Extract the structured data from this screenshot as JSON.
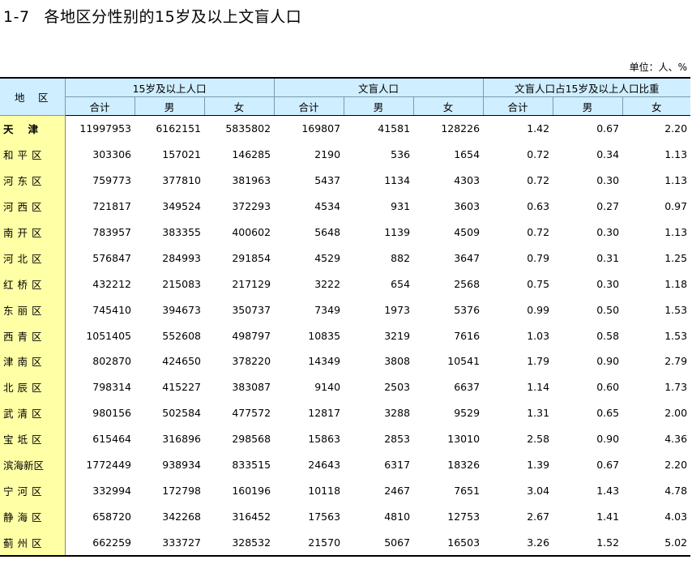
{
  "title": {
    "number": "1-7",
    "text": "各地区分性别的15岁及以上文盲人口"
  },
  "unit": "单位：人、%",
  "header": {
    "region": "地　区",
    "groups": [
      "15岁及以上人口",
      "文盲人口",
      "文盲人口占15岁及以上人口比重"
    ],
    "sub": [
      "合计",
      "男",
      "女",
      "合计",
      "男",
      "女",
      "合计",
      "男",
      "女"
    ]
  },
  "rows": [
    {
      "region": "天津",
      "values": [
        "11997953",
        "6162151",
        "5835802",
        "169807",
        "41581",
        "128226",
        "1.42",
        "0.67",
        "2.20"
      ]
    },
    {
      "region": "和平区",
      "values": [
        "303306",
        "157021",
        "146285",
        "2190",
        "536",
        "1654",
        "0.72",
        "0.34",
        "1.13"
      ]
    },
    {
      "region": "河东区",
      "values": [
        "759773",
        "377810",
        "381963",
        "5437",
        "1134",
        "4303",
        "0.72",
        "0.30",
        "1.13"
      ]
    },
    {
      "region": "河西区",
      "values": [
        "721817",
        "349524",
        "372293",
        "4534",
        "931",
        "3603",
        "0.63",
        "0.27",
        "0.97"
      ]
    },
    {
      "region": "南开区",
      "values": [
        "783957",
        "383355",
        "400602",
        "5648",
        "1139",
        "4509",
        "0.72",
        "0.30",
        "1.13"
      ]
    },
    {
      "region": "河北区",
      "values": [
        "576847",
        "284993",
        "291854",
        "4529",
        "882",
        "3647",
        "0.79",
        "0.31",
        "1.25"
      ]
    },
    {
      "region": "红桥区",
      "values": [
        "432212",
        "215083",
        "217129",
        "3222",
        "654",
        "2568",
        "0.75",
        "0.30",
        "1.18"
      ]
    },
    {
      "region": "东丽区",
      "values": [
        "745410",
        "394673",
        "350737",
        "7349",
        "1973",
        "5376",
        "0.99",
        "0.50",
        "1.53"
      ]
    },
    {
      "region": "西青区",
      "values": [
        "1051405",
        "552608",
        "498797",
        "10835",
        "3219",
        "7616",
        "1.03",
        "0.58",
        "1.53"
      ]
    },
    {
      "region": "津南区",
      "values": [
        "802870",
        "424650",
        "378220",
        "14349",
        "3808",
        "10541",
        "1.79",
        "0.90",
        "2.79"
      ]
    },
    {
      "region": "北辰区",
      "values": [
        "798314",
        "415227",
        "383087",
        "9140",
        "2503",
        "6637",
        "1.14",
        "0.60",
        "1.73"
      ]
    },
    {
      "region": "武清区",
      "values": [
        "980156",
        "502584",
        "477572",
        "12817",
        "3288",
        "9529",
        "1.31",
        "0.65",
        "2.00"
      ]
    },
    {
      "region": "宝坻区",
      "values": [
        "615464",
        "316896",
        "298568",
        "15863",
        "2853",
        "13010",
        "2.58",
        "0.90",
        "4.36"
      ]
    },
    {
      "region": "滨海新区",
      "values": [
        "1772449",
        "938934",
        "833515",
        "24643",
        "6317",
        "18326",
        "1.39",
        "0.67",
        "2.20"
      ]
    },
    {
      "region": "宁河区",
      "values": [
        "332994",
        "172798",
        "160196",
        "10118",
        "2467",
        "7651",
        "3.04",
        "1.43",
        "4.78"
      ]
    },
    {
      "region": "静海区",
      "values": [
        "658720",
        "342268",
        "316452",
        "17563",
        "4810",
        "12753",
        "2.67",
        "1.41",
        "4.03"
      ]
    },
    {
      "region": "蓟州区",
      "values": [
        "662259",
        "333727",
        "328532",
        "21570",
        "5067",
        "16503",
        "3.26",
        "1.52",
        "5.02"
      ]
    }
  ]
}
